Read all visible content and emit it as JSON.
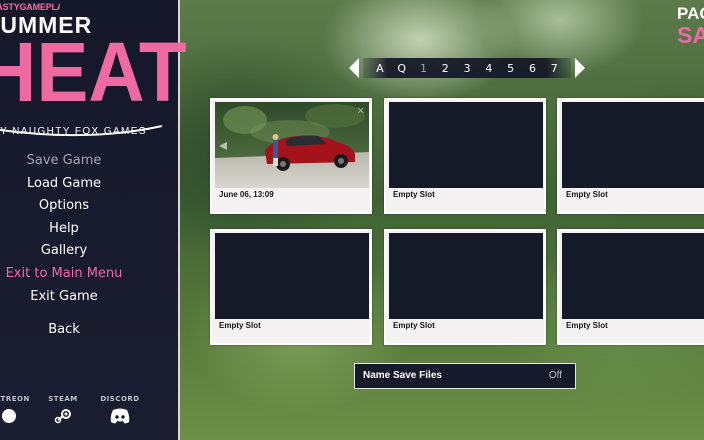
{
  "app": {
    "logo": {
      "brand": "NASTYGAMEPLAYS",
      "title_line1": "SUMMER",
      "title_line2": "HEAT",
      "byline": "BY NAUGHTY FOX GAMES"
    },
    "accent_color": "#ef6aa5"
  },
  "sidebar": {
    "menu": [
      {
        "label": "Save Game",
        "state": "disabled"
      },
      {
        "label": "Load Game",
        "state": "normal"
      },
      {
        "label": "Options",
        "state": "normal"
      },
      {
        "label": "Help",
        "state": "normal"
      },
      {
        "label": "Gallery",
        "state": "normal"
      },
      {
        "label": "Exit to Main Menu",
        "state": "highlight"
      },
      {
        "label": "Exit Game",
        "state": "normal"
      }
    ],
    "back_label": "Back",
    "social": [
      {
        "label": "PATREON",
        "icon": "patreon-icon"
      },
      {
        "label": "STEAM",
        "icon": "steam-icon"
      },
      {
        "label": "DISCORD",
        "icon": "discord-icon"
      }
    ]
  },
  "header": {
    "page_label": "PAGE",
    "page_value": "SAVE"
  },
  "pager": {
    "pages": [
      "A",
      "Q",
      "1",
      "2",
      "3",
      "4",
      "5",
      "6",
      "7"
    ],
    "current": "1"
  },
  "slots": [
    {
      "label": "June 06, 13:09",
      "has_screenshot": true
    },
    {
      "label": "Empty Slot",
      "has_screenshot": false
    },
    {
      "label": "Empty Slot",
      "has_screenshot": false
    },
    {
      "label": "Empty Slot",
      "has_screenshot": false
    },
    {
      "label": "Empty Slot",
      "has_screenshot": false
    },
    {
      "label": "Empty Slot",
      "has_screenshot": false
    }
  ],
  "name_save_files": {
    "label": "Name Save Files",
    "value": "Off"
  }
}
